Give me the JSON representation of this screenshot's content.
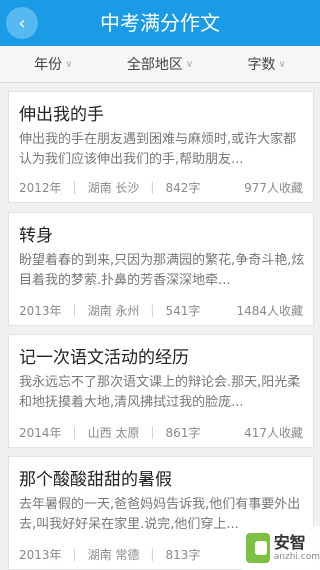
{
  "header": {
    "back_icon": "chevron-left-icon",
    "title": "中考满分作文"
  },
  "filters": [
    {
      "label": "年份"
    },
    {
      "label": "全部地区"
    },
    {
      "label": "字数"
    }
  ],
  "essays": [
    {
      "title": "伸出我的手",
      "excerpt": "伸出我的手在朋友遇到困难与麻烦时,或许大家都认为我们应该伸出我们的手,帮助朋友...",
      "year": "2012年",
      "region": "湖南 长沙",
      "words": "842字",
      "favorites": "977人收藏"
    },
    {
      "title": "转身",
      "excerpt": "盼望着春的到来,只因为那满园的繁花,争奇斗艳,炫目着我的梦萦.扑鼻的芳香深深地牵...",
      "year": "2013年",
      "region": "湖南 永州",
      "words": "541字",
      "favorites": "1484人收藏"
    },
    {
      "title": "记一次语文活动的经历",
      "excerpt": "我永远忘不了那次语文课上的辩论会.那天,阳光柔和地抚摸着大地,清风拂拭过我的脸庞...",
      "year": "2014年",
      "region": "山西 太原",
      "words": "861字",
      "favorites": "417人收藏"
    },
    {
      "title": "那个酸酸甜甜的暑假",
      "excerpt": "去年暑假的一天,爸爸妈妈告诉我,他们有事要外出去,叫我好好呆在家里.说完,他们穿上...",
      "year": "2013年",
      "region": "湖南 常德",
      "words": "813字",
      "favorites": ""
    }
  ],
  "watermark": {
    "name": "安智",
    "domain": "anzhi.com",
    "icon": "android-logo-icon"
  }
}
